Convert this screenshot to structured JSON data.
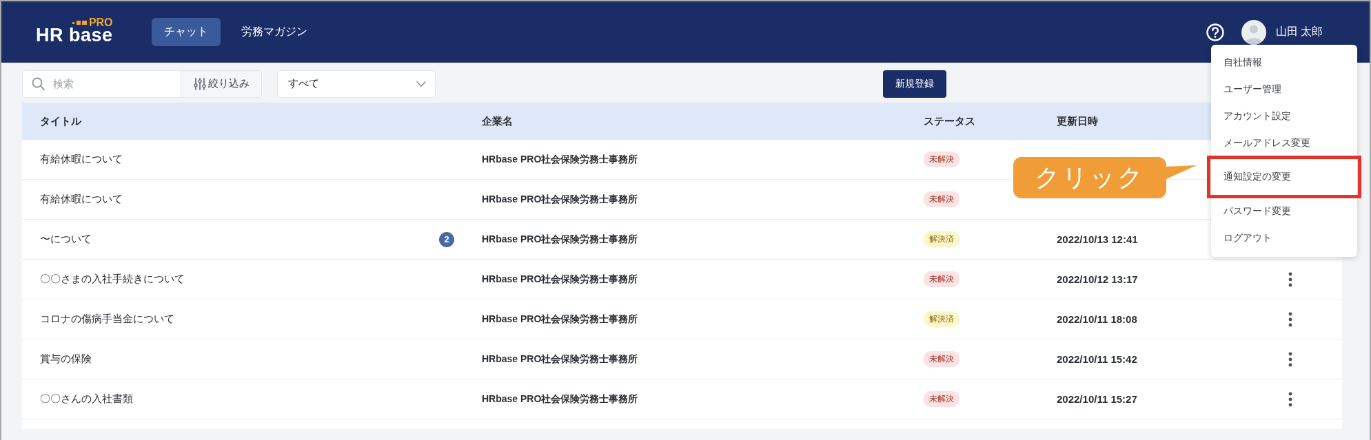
{
  "header": {
    "logo": {
      "name": "HR base",
      "edition": "PRO"
    },
    "nav": [
      {
        "label": "チャット",
        "selected": true
      },
      {
        "label": "労務マガジン",
        "selected": false
      }
    ],
    "user": {
      "name": "山田 太郎"
    }
  },
  "toolbar": {
    "search": {
      "placeholder": "検索"
    },
    "filter_button": "絞り込み",
    "status_select": "すべて",
    "new_button": "新規登録"
  },
  "table": {
    "columns": [
      "タイトル",
      "企業名",
      "ステータス",
      "更新日時"
    ],
    "rows": [
      {
        "title": "有給休暇について",
        "company": "HRbase PRO社会保険労務士事務所",
        "status": "未解決",
        "resolved": false,
        "more_button": false
      },
      {
        "title": "有給休暇について",
        "company": "HRbase PRO社会保険労務士事務所",
        "status": "未解決",
        "resolved": false,
        "more_button": false
      },
      {
        "title": "〜について",
        "unread": "2",
        "company": "HRbase PRO社会保険労務士事務所",
        "status": "解決済",
        "resolved": true,
        "updated": "2022/10/13 12:41",
        "more_button": false
      },
      {
        "title": "〇〇さまの入社手続きについて",
        "company": "HRbase PRO社会保険労務士事務所",
        "status": "未解決",
        "resolved": false,
        "updated": "2022/10/12 13:17",
        "more_button": true
      },
      {
        "title": "コロナの傷病手当金について",
        "company": "HRbase PRO社会保険労務士事務所",
        "status": "解決済",
        "resolved": true,
        "updated": "2022/10/11 18:08",
        "more_button": true
      },
      {
        "title": "賞与の保険",
        "company": "HRbase PRO社会保険労務士事務所",
        "status": "未解決",
        "resolved": false,
        "updated": "2022/10/11 15:42",
        "more_button": true
      },
      {
        "title": "〇〇さんの入社書類",
        "company": "HRbase PRO社会保険労務士事務所",
        "status": "未解決",
        "resolved": false,
        "updated": "2022/10/11 15:27",
        "more_button": true
      }
    ]
  },
  "user_menu": {
    "items": [
      {
        "label": "自社情報",
        "highlighted": false
      },
      {
        "label": "ユーザー管理",
        "highlighted": false
      },
      {
        "label": "アカウント設定",
        "highlighted": false
      },
      {
        "label": "メールアドレス変更",
        "highlighted": false
      },
      {
        "label": "通知設定の変更",
        "highlighted": true
      },
      {
        "label": "パスワード変更",
        "highlighted": false
      },
      {
        "label": "ログアウト",
        "highlighted": false
      }
    ]
  },
  "callout": {
    "text": "クリック"
  }
}
